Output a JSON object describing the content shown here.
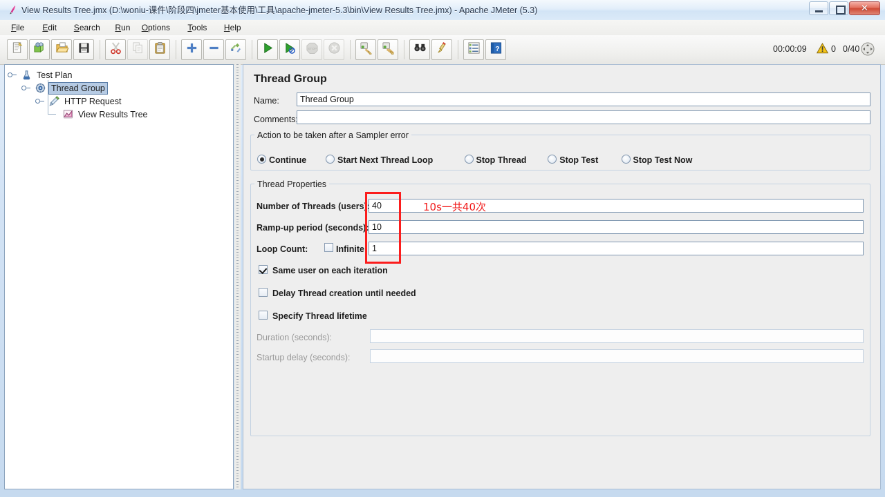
{
  "window": {
    "title": "View Results Tree.jmx (D:\\woniu-课件\\阶段四\\jmeter基本使用\\工具\\apache-jmeter-5.3\\bin\\View Results Tree.jmx) - Apache JMeter (5.3)",
    "app_icon": "jmeter-feather-icon",
    "controls": {
      "minimize": "minimize-button",
      "maximize": "maximize-button",
      "close_label": "✕"
    }
  },
  "menubar": {
    "items": [
      {
        "label": "File",
        "mnemonic": "F"
      },
      {
        "label": "Edit",
        "mnemonic": "E"
      },
      {
        "label": "Search",
        "mnemonic": "S"
      },
      {
        "label": "Run",
        "mnemonic": "R"
      },
      {
        "label": "Options",
        "mnemonic": "O"
      },
      {
        "label": "Tools",
        "mnemonic": "T"
      },
      {
        "label": "Help",
        "mnemonic": "H"
      }
    ]
  },
  "toolbar": {
    "buttons": [
      {
        "name": "new-icon",
        "enabled": true
      },
      {
        "name": "templates-icon",
        "enabled": true
      },
      {
        "name": "open-icon",
        "enabled": true
      },
      {
        "name": "save-icon",
        "enabled": true
      },
      {
        "name": "cut-icon",
        "enabled": true
      },
      {
        "name": "copy-icon",
        "enabled": false
      },
      {
        "name": "paste-icon",
        "enabled": true
      },
      {
        "name": "expand-all-icon",
        "enabled": true
      },
      {
        "name": "collapse-all-icon",
        "enabled": true
      },
      {
        "name": "toggle-icon",
        "enabled": true
      },
      {
        "name": "start-icon",
        "enabled": true
      },
      {
        "name": "start-no-pauses-icon",
        "enabled": true
      },
      {
        "name": "stop-icon",
        "enabled": false
      },
      {
        "name": "shutdown-icon",
        "enabled": false
      },
      {
        "name": "clear-icon",
        "enabled": true
      },
      {
        "name": "clear-all-icon",
        "enabled": true
      },
      {
        "name": "search-icon",
        "enabled": true
      },
      {
        "name": "search-reset-icon",
        "enabled": true
      },
      {
        "name": "function-helper-icon",
        "enabled": true
      },
      {
        "name": "help-icon",
        "enabled": true
      }
    ],
    "timer": "00:00:09",
    "warning_icon": "warning-triangle-icon",
    "warning_count": "0",
    "thread_count": "0/40",
    "expand_icon": "expand-arrows-icon"
  },
  "tree": {
    "nodes": [
      {
        "label": "Test Plan",
        "icon": "test-plan-icon",
        "depth": 0,
        "selected": false
      },
      {
        "label": "Thread Group",
        "icon": "thread-group-icon",
        "depth": 1,
        "selected": true
      },
      {
        "label": "HTTP Request",
        "icon": "http-request-icon",
        "depth": 2,
        "selected": false
      },
      {
        "label": "View Results Tree",
        "icon": "view-results-tree-icon",
        "depth": 3,
        "selected": false
      }
    ]
  },
  "main": {
    "panel_title": "Thread Group",
    "name_label": "Name:",
    "name_value": "Thread Group",
    "comments_label": "Comments:",
    "comments_value": "",
    "sampler_error_group": {
      "title": "Action to be taken after a Sampler error",
      "options": [
        {
          "label": "Continue",
          "selected": true
        },
        {
          "label": "Start Next Thread Loop",
          "selected": false
        },
        {
          "label": "Stop Thread",
          "selected": false
        },
        {
          "label": "Stop Test",
          "selected": false
        },
        {
          "label": "Stop Test Now",
          "selected": false
        }
      ]
    },
    "thread_properties_group": {
      "title": "Thread Properties",
      "num_threads_label": "Number of Threads (users):",
      "num_threads_value": "40",
      "rampup_label": "Ramp-up period (seconds):",
      "rampup_value": "10",
      "loop_count_label": "Loop Count:",
      "infinite_label": "Infinite",
      "infinite_checked": false,
      "loop_count_value": "1",
      "same_user_label": "Same user on each iteration",
      "same_user_checked": true,
      "delay_thread_label": "Delay Thread creation until needed",
      "delay_thread_checked": false,
      "specify_lifetime_label": "Specify Thread lifetime",
      "specify_lifetime_checked": false,
      "duration_label": "Duration (seconds):",
      "duration_value": "",
      "duration_enabled": false,
      "startup_delay_label": "Startup delay (seconds):",
      "startup_delay_value": "",
      "startup_delay_enabled": false
    }
  },
  "annotation": {
    "text": "10s一共40次",
    "color": "#f11c1c",
    "box_color": "#fb1d1d"
  }
}
